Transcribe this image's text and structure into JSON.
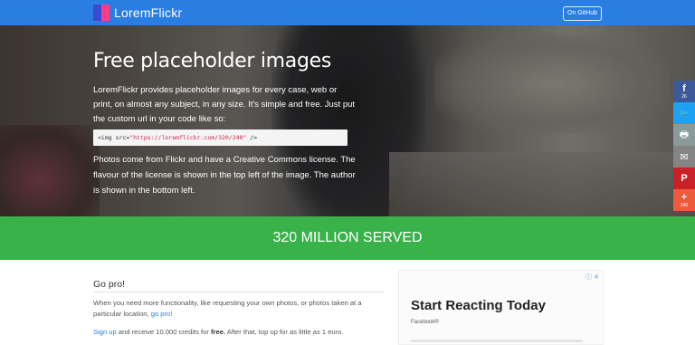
{
  "navbar": {
    "brand": "LoremFlickr",
    "github_label": "On GitHub"
  },
  "hero": {
    "title": "Free placeholder images",
    "intro": "LoremFlickr provides placeholder images for every case, web or print, on almost any subject, in any size. It's simple and free. Just put the custom url in your code like so:",
    "code_prefix": "<img src=",
    "code_url": "\"https://loremflickr.com/320/240\"",
    "code_suffix": " />",
    "license_text": "Photos come from Flickr and have a Creative Commons license. The flavour of the license is shown in the top left of the image. The author is shown in the bottom left."
  },
  "share": {
    "facebook_icon": "f",
    "facebook_count": "26",
    "twitter_icon": "🐦",
    "print_icon": "🖶",
    "email_icon": "✉",
    "pinterest_icon": "P",
    "more_icon": "+",
    "more_count": "140"
  },
  "stats": {
    "text": "320 MILLION SERVED"
  },
  "gopro": {
    "title": "Go pro!",
    "p1_text": "When you need more functionality, like requesting your own photos, or photos taken at a particular location, ",
    "p1_link": "go pro!",
    "p2_link": "Sign up",
    "p2_text_a": " and receive 10.000 credits for ",
    "p2_bold": "free.",
    "p2_text_b": " After that, top up for as little as 1 euro."
  },
  "ad": {
    "icons": "ⓘ ✕",
    "title": "Start Reacting Today",
    "source": "Facebook®"
  },
  "colors": {
    "navbar": "#2a7de1",
    "stats_banner": "#39b24a",
    "logo_blue": "#3b4bd1",
    "logo_pink": "#ff3b8a"
  }
}
